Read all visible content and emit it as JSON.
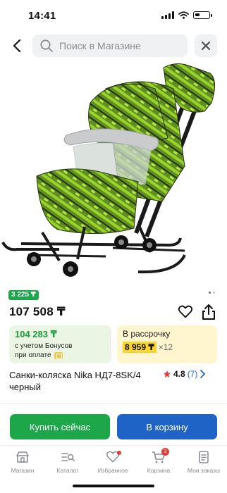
{
  "status_bar": {
    "time": "14:41"
  },
  "search": {
    "placeholder": "Поиск в Магазине"
  },
  "product": {
    "bonus_badge": "3 225 ₸",
    "price": "107 508 ₸",
    "title": "Санки-коляска Nika НД7-8SK/4 черный",
    "rating_value": "4.8",
    "review_count": "(7)",
    "image_icon": "sled-stroller-photo"
  },
  "bonus_card": {
    "price": "104 283 ₸",
    "note1": "с учетом Бонусов",
    "note2": "при оплате"
  },
  "installment_card": {
    "label": "В рассрочку",
    "amount": "8 959 ₸",
    "term": "×12"
  },
  "actions": {
    "buy_now": "Купить сейчас",
    "to_cart": "В корзину"
  },
  "tabs": [
    {
      "label": "Магазин",
      "icon": "shop-icon"
    },
    {
      "label": "Каталог",
      "icon": "catalog-icon"
    },
    {
      "label": "Избранное",
      "icon": "heart-icon"
    },
    {
      "label": "Корзина",
      "icon": "cart-icon",
      "badge": "3"
    },
    {
      "label": "Мои заказы",
      "icon": "orders-icon"
    }
  ],
  "colors": {
    "accent_green": "#1ea64a",
    "accent_blue": "#1f63c6",
    "installment_yellow": "#fcd52c",
    "badge_red": "#e53935"
  }
}
